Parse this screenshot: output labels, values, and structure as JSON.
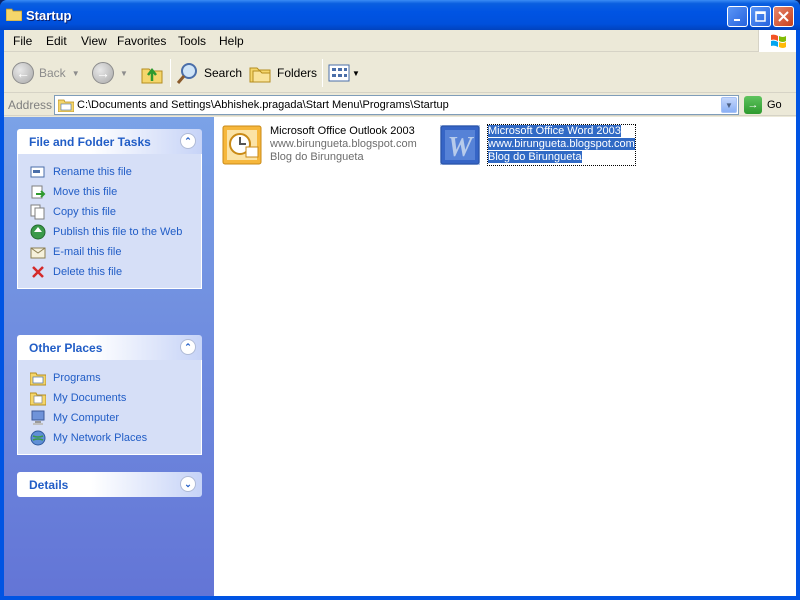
{
  "window": {
    "title": "Startup",
    "buttons": {
      "minimize": "minimize",
      "maximize": "maximize",
      "close": "close"
    }
  },
  "menubar": {
    "items": [
      "File",
      "Edit",
      "View",
      "Favorites",
      "Tools",
      "Help"
    ]
  },
  "toolbar": {
    "back_label": "Back",
    "search_label": "Search",
    "folders_label": "Folders"
  },
  "address": {
    "label": "Address",
    "path": "C:\\Documents and Settings\\Abhishek.pragada\\Start Menu\\Programs\\Startup",
    "go_label": "Go"
  },
  "sidebar": {
    "file_tasks": {
      "title": "File and Folder Tasks",
      "items": [
        {
          "label": "Rename this file",
          "icon": "rename-icon"
        },
        {
          "label": "Move this file",
          "icon": "move-icon"
        },
        {
          "label": "Copy this file",
          "icon": "copy-icon"
        },
        {
          "label": "Publish this file to the Web",
          "icon": "publish-web-icon"
        },
        {
          "label": "E-mail this file",
          "icon": "email-icon"
        },
        {
          "label": "Delete this file",
          "icon": "delete-icon"
        }
      ]
    },
    "other_places": {
      "title": "Other Places",
      "items": [
        {
          "label": "Programs",
          "icon": "programs-folder-icon"
        },
        {
          "label": "My Documents",
          "icon": "my-documents-icon"
        },
        {
          "label": "My Computer",
          "icon": "my-computer-icon"
        },
        {
          "label": "My Network Places",
          "icon": "network-places-icon"
        }
      ]
    },
    "details": {
      "title": "Details"
    }
  },
  "files": [
    {
      "name": "Microsoft Office Outlook 2003",
      "line2": "www.birungueta.blogspot.com",
      "line3": "Blog do Birungueta",
      "icon": "outlook-shortcut-icon",
      "selected": false
    },
    {
      "name": "Microsoft Office Word 2003",
      "line2": "www.birungueta.blogspot.com",
      "line3": "Blog do Birungueta",
      "icon": "word-shortcut-icon",
      "selected": true
    }
  ],
  "colors": {
    "titlebar": "#0054e3",
    "task_link": "#215dc6",
    "selection": "#316ac5"
  }
}
